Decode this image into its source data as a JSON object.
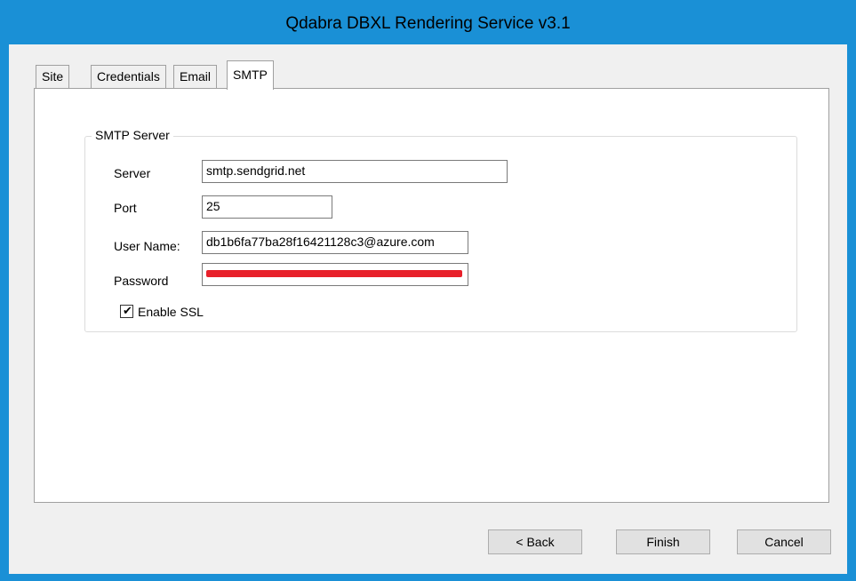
{
  "window": {
    "title": "Qdabra DBXL Rendering Service v3.1"
  },
  "tabs": [
    {
      "label": "Site"
    },
    {
      "label": "Credentials"
    },
    {
      "label": "Email"
    },
    {
      "label": "SMTP",
      "active": true
    }
  ],
  "smtp_group": {
    "title": "SMTP Server",
    "server": {
      "label": "Server",
      "value": "smtp.sendgrid.net"
    },
    "port": {
      "label": "Port",
      "value": "25"
    },
    "username": {
      "label": "User Name:",
      "value": "db1b6fa77ba28f16421128c3@azure.com"
    },
    "password": {
      "label": "Password",
      "value": "",
      "redacted": true
    },
    "ssl": {
      "label": "Enable SSL",
      "checked": true
    }
  },
  "buttons": {
    "back": "< Back",
    "finish": "Finish",
    "cancel": "Cancel"
  },
  "colors": {
    "titlebar": "#1a90d6",
    "redaction": "#e8202a",
    "dialog_bg": "#f0f0f0"
  }
}
